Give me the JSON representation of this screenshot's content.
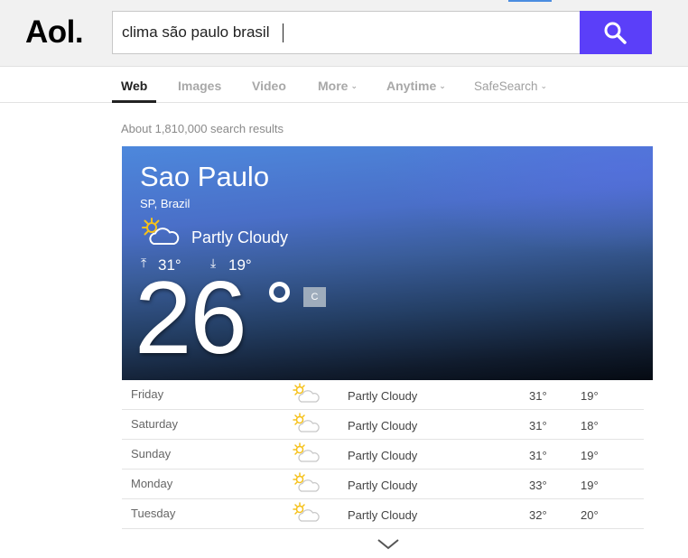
{
  "header": {
    "logo": "Aol.",
    "search_value": "clima são paulo brasil",
    "search_button_icon": "search-icon",
    "accent_color": "#5b3ff9"
  },
  "nav": {
    "tabs": [
      {
        "label": "Web",
        "active": true
      },
      {
        "label": "Images",
        "active": false
      },
      {
        "label": "Video",
        "active": false
      },
      {
        "label": "More",
        "active": false
      },
      {
        "label": "Anytime",
        "active": false
      },
      {
        "label": "SafeSearch",
        "active": false
      }
    ]
  },
  "results": {
    "count_text": "About 1,810,000 search results"
  },
  "weather": {
    "city": "Sao Paulo",
    "region": "SP, Brazil",
    "condition": "Partly Cloudy",
    "condition_icon": "partly-cloudy-icon",
    "high": "31°",
    "low": "19°",
    "current_temp": "26",
    "unit": "C",
    "forecast": [
      {
        "day": "Friday",
        "condition": "Partly Cloudy",
        "high": "31°",
        "low": "19°"
      },
      {
        "day": "Saturday",
        "condition": "Partly Cloudy",
        "high": "31°",
        "low": "18°"
      },
      {
        "day": "Sunday",
        "condition": "Partly Cloudy",
        "high": "31°",
        "low": "19°"
      },
      {
        "day": "Monday",
        "condition": "Partly Cloudy",
        "high": "33°",
        "low": "19°"
      },
      {
        "day": "Tuesday",
        "condition": "Partly Cloudy",
        "high": "32°",
        "low": "20°"
      }
    ]
  }
}
